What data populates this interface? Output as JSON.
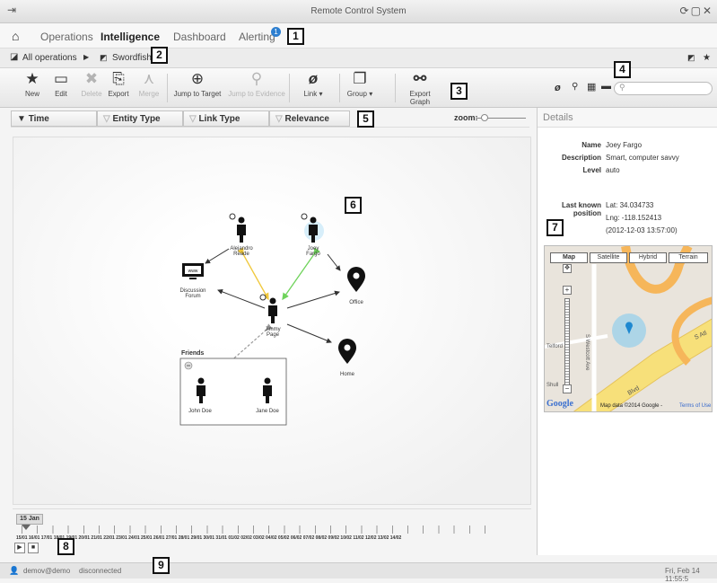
{
  "app": {
    "title": "Remote Control System",
    "window_controls": "⟳▢✕"
  },
  "nav": {
    "items": [
      {
        "label": "Operations"
      },
      {
        "label": "Intelligence"
      },
      {
        "label": "Dashboard"
      },
      {
        "label": "Alerting"
      }
    ],
    "alert_count": "1",
    "active": "Intelligence"
  },
  "breadcrumb": {
    "root": "All operations",
    "current": "Swordfish"
  },
  "toolbar": {
    "buttons": [
      {
        "label": "New",
        "icon": "★"
      },
      {
        "label": "Edit",
        "icon": "▭"
      },
      {
        "label": "Delete",
        "icon": "✖"
      },
      {
        "label": "Export",
        "icon": "⎘"
      },
      {
        "label": "Merge",
        "icon": "⋏"
      },
      {
        "label": "Jump to Target",
        "icon": "⊕"
      },
      {
        "label": "Jump to Evidence",
        "icon": "⚲"
      },
      {
        "label": "Link",
        "icon": "ø"
      },
      {
        "label": "Group",
        "icon": "❐"
      },
      {
        "label": "Export Graph",
        "icon": "⚯"
      }
    ],
    "search_placeholder": ""
  },
  "filters": {
    "columns": [
      "Time",
      "Entity Type",
      "Link Type",
      "Relevance"
    ],
    "zoom_label": "zoom:"
  },
  "graph": {
    "nodes": [
      {
        "id": "alejandro",
        "label": "Alejandro",
        "label2": "Reade"
      },
      {
        "id": "joey",
        "label": "Joey",
        "label2": "Fargo"
      },
      {
        "id": "forum",
        "label": "Discussion",
        "label2": "Forum"
      },
      {
        "id": "office",
        "label": "Office",
        "label2": ""
      },
      {
        "id": "jimmy",
        "label": "Jimmy",
        "label2": "Page"
      },
      {
        "id": "home",
        "label": "Home",
        "label2": ""
      },
      {
        "id": "john",
        "label": "John Doe",
        "label2": ""
      },
      {
        "id": "jane",
        "label": "Jane Doe",
        "label2": ""
      }
    ],
    "group_label": "Friends",
    "www": "www"
  },
  "details": {
    "header": "Details",
    "name_label": "Name",
    "name": "Joey Fargo",
    "desc_label": "Description",
    "desc": "Smart, computer savvy",
    "level_label": "Level",
    "level": "auto",
    "pos_label": "Last known position",
    "lat": "Lat: 34.034733",
    "lng": "Lng: -118.152413",
    "time": "(2012-12-03 13:57:00)"
  },
  "map": {
    "tabs": [
      "Map",
      "Satellite",
      "Hybrid",
      "Terrain"
    ],
    "attribution": "Map data ©2014 Google - ",
    "terms": "Terms of Use",
    "google": "Google",
    "streets": [
      "S Westcott Ave",
      "Telford",
      "Shull",
      "Blvd",
      "S Atl"
    ]
  },
  "timeline": {
    "current": "15 Jan",
    "dates": "15/01 16/01 17/01 18/01 19/01 20/01 21/01 22/01 23/01 24/01 25/01 26/01 27/01 28/01 29/01 30/01 31/01 01/02 02/02 03/02 04/02 05/02 06/02 07/02 08/02 09/02 10/02 11/02 12/02 13/02 14/02"
  },
  "status": {
    "user": "demov@demo",
    "state": "disconnected",
    "datetime": "Fri, Feb 14  11:55:5"
  },
  "callouts": [
    "1",
    "2",
    "3",
    "4",
    "5",
    "6",
    "7",
    "8",
    "9"
  ]
}
